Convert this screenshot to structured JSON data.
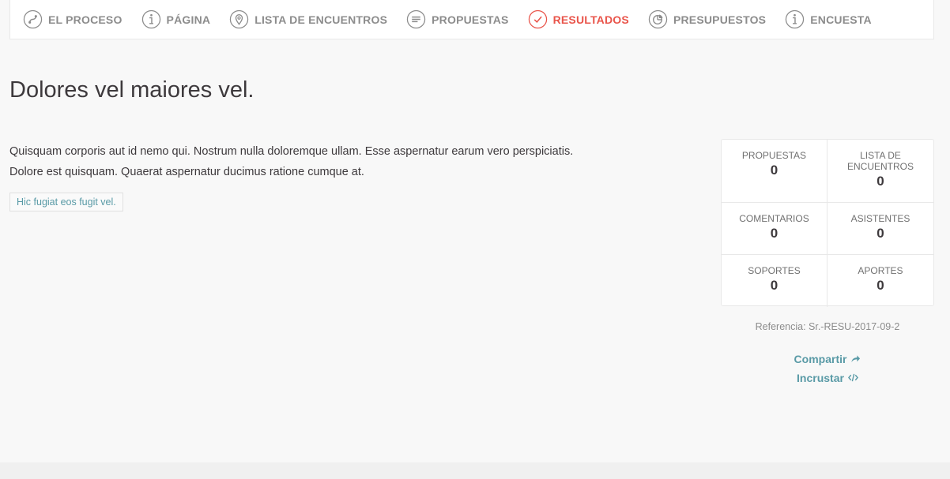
{
  "tabs": [
    {
      "label": "EL PROCESO",
      "icon": "process-icon",
      "active": false
    },
    {
      "label": "PÁGINA",
      "icon": "info-icon",
      "active": false
    },
    {
      "label": "LISTA DE ENCUENTROS",
      "icon": "map-pin-icon",
      "active": false
    },
    {
      "label": "PROPUESTAS",
      "icon": "lines-icon",
      "active": false
    },
    {
      "label": "RESULTADOS",
      "icon": "check-icon",
      "active": true
    },
    {
      "label": "PRESUPUESTOS",
      "icon": "pie-chart-icon",
      "active": false
    },
    {
      "label": "ENCUESTA",
      "icon": "info-icon",
      "active": false
    }
  ],
  "title": "Dolores vel maiores vel.",
  "description": {
    "line1": "Quisquam corporis aut id nemo qui. Nostrum nulla doloremque ullam. Esse aspernatur earum vero perspiciatis.",
    "line2": "Dolore est quisquam. Quaerat aspernatur ducimus ratione cumque at."
  },
  "tag": "Hic fugiat eos fugit vel.",
  "stats": {
    "proposals": {
      "label": "PROPUESTAS",
      "value": "0"
    },
    "meetings": {
      "label": "LISTA DE ENCUENTROS",
      "value": "0"
    },
    "comments": {
      "label": "COMENTARIOS",
      "value": "0"
    },
    "attendees": {
      "label": "ASISTENTES",
      "value": "0"
    },
    "supports": {
      "label": "SOPORTES",
      "value": "0"
    },
    "contributions": {
      "label": "APORTES",
      "value": "0"
    }
  },
  "reference": "Referencia: Sr.-RESU-2017-09-2",
  "actions": {
    "share": "Compartir",
    "embed": "Incrustar"
  },
  "colors": {
    "active_tab": "#e9544a",
    "link": "#599aa6",
    "muted": "#8c8c8c"
  }
}
